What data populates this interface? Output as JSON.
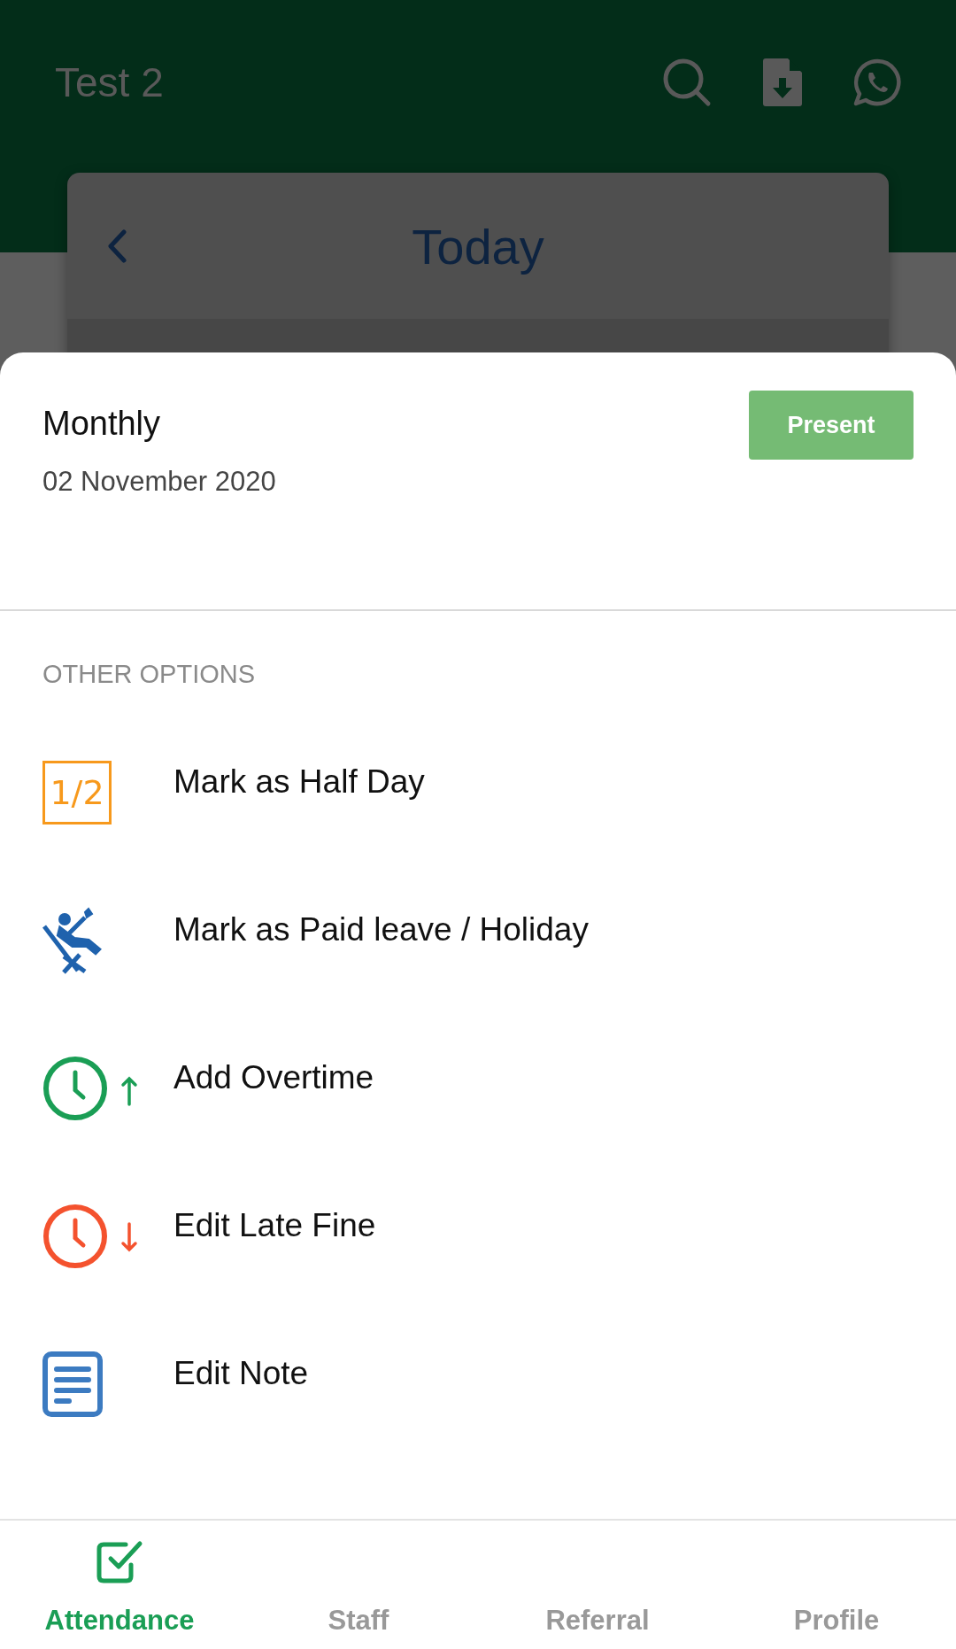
{
  "app_bar": {
    "title": "Test 2"
  },
  "date_card": {
    "title": "Today"
  },
  "sheet": {
    "plan": "Monthly",
    "date": "02 November 2020",
    "status_button": "Present",
    "section_title": "OTHER OPTIONS",
    "options": [
      {
        "kind": "half_day",
        "label": "Mark as Half Day",
        "icon_text": "1/2"
      },
      {
        "kind": "leave",
        "label": "Mark as Paid leave / Holiday"
      },
      {
        "kind": "overtime",
        "label": "Add Overtime"
      },
      {
        "kind": "late_fine",
        "label": "Edit Late Fine"
      },
      {
        "kind": "note",
        "label": "Edit Note"
      }
    ]
  },
  "bottom_nav": [
    {
      "label": "Attendance",
      "selected": true
    },
    {
      "label": "Staff",
      "selected": false
    },
    {
      "label": "Referral",
      "selected": false
    },
    {
      "label": "Profile",
      "selected": false
    }
  ]
}
